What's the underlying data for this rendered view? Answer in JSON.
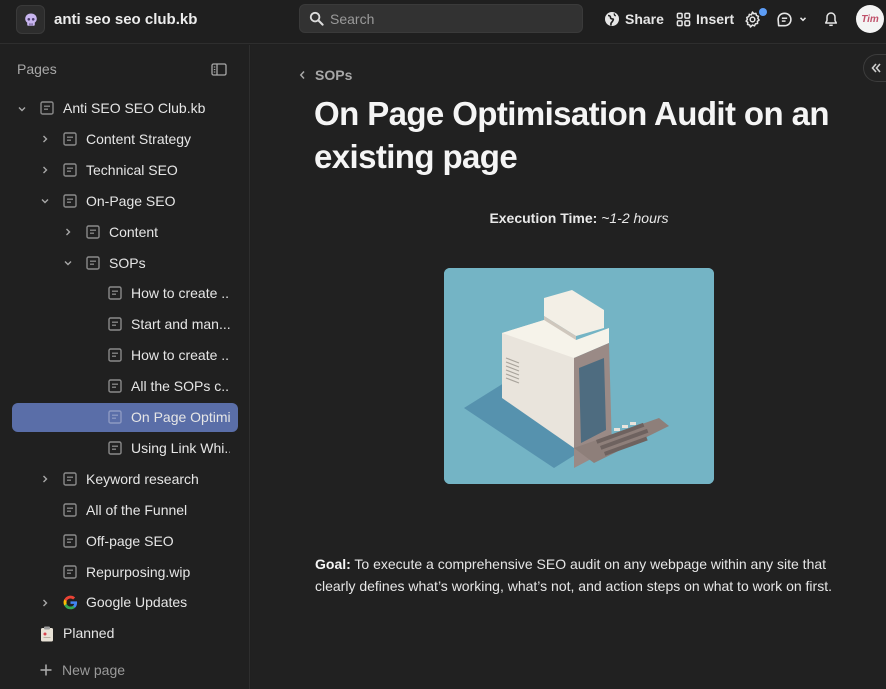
{
  "topbar": {
    "workspace_name": "anti seo seo club.kb",
    "search_placeholder": "Search",
    "share_label": "Share",
    "insert_label": "Insert",
    "avatar_text": "Tim",
    "notification_dot_color": "#5c9cf5"
  },
  "sidebar": {
    "header": "Pages",
    "items": [
      {
        "label": "Anti SEO SEO Club.kb",
        "depth": 0,
        "chevron": "down",
        "icon": "doc-icon"
      },
      {
        "label": "Content Strategy",
        "depth": 1,
        "chevron": "right",
        "icon": "doc-icon"
      },
      {
        "label": "Technical SEO",
        "depth": 1,
        "chevron": "right",
        "icon": "doc-icon"
      },
      {
        "label": "On-Page SEO",
        "depth": 1,
        "chevron": "down",
        "icon": "doc-icon"
      },
      {
        "label": "Content",
        "depth": 2,
        "chevron": "right",
        "icon": "doc-icon"
      },
      {
        "label": "SOPs",
        "depth": 2,
        "chevron": "down",
        "icon": "doc-icon"
      },
      {
        "label": "How to create ...",
        "depth": 3,
        "chevron": "none",
        "icon": "doc-icon"
      },
      {
        "label": "Start and man...",
        "depth": 3,
        "chevron": "none",
        "icon": "doc-icon"
      },
      {
        "label": "How to create ...",
        "depth": 3,
        "chevron": "none",
        "icon": "doc-icon"
      },
      {
        "label": "All the SOPs c...",
        "depth": 3,
        "chevron": "none",
        "icon": "doc-icon"
      },
      {
        "label": "On Page Optimis",
        "depth": 3,
        "chevron": "none",
        "icon": "doc-icon",
        "active": true
      },
      {
        "label": "Using Link Whi...",
        "depth": 3,
        "chevron": "none",
        "icon": "doc-icon"
      },
      {
        "label": "Keyword research",
        "depth": 1,
        "chevron": "right",
        "icon": "doc-icon"
      },
      {
        "label": "All of the Funnel",
        "depth": 1,
        "chevron": "none",
        "icon": "doc-icon"
      },
      {
        "label": "Off-page SEO",
        "depth": 1,
        "chevron": "none",
        "icon": "doc-icon"
      },
      {
        "label": "Repurposing.wip",
        "depth": 1,
        "chevron": "none",
        "icon": "doc-icon"
      },
      {
        "label": "Google Updates",
        "depth": 1,
        "chevron": "right",
        "icon": "google-icon"
      },
      {
        "label": "Planned",
        "depth": 0,
        "chevron": "none",
        "icon": "clipboard-icon"
      }
    ],
    "new_page_label": "New page",
    "active_color": "#5a6ea8"
  },
  "main": {
    "breadcrumb": "SOPs",
    "title": "On Page Optimisation Audit on an existing page",
    "execution_label": "Execution Time:",
    "execution_value": "~1-2 hours",
    "hero_image_alt": "retro computer illustration",
    "goal_label": "Goal:",
    "goal_text": " To execute a comprehensive SEO audit on any webpage within any site that clearly defines what’s working, what’s not, and action steps on what to work on first."
  }
}
